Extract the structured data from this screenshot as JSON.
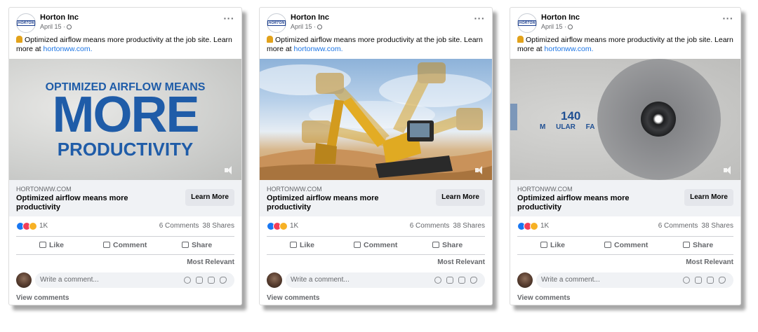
{
  "posts": [
    {
      "page_name": "Horton Inc",
      "logo_text": "HORTON",
      "date": "April 15 ·",
      "message": "Optimized airflow means more productivity at the job site. Learn more at",
      "message_link": "hortonww.com.",
      "media": {
        "type": "text-graphic",
        "line1": "OPTIMIZED AIRFLOW MEANS",
        "line2": "MORE",
        "line3": "PRODUCTIVITY"
      },
      "link_domain": "HORTONWW.COM",
      "link_title": "Optimized airflow means more productivity",
      "cta": "Learn More",
      "reaction_count": "1K",
      "comments": "6 Comments",
      "shares": "38 Shares",
      "actions": {
        "like": "Like",
        "comment": "Comment",
        "share": "Share"
      },
      "sort": "Most Relevant",
      "comment_placeholder": "Write a comment...",
      "view_comments": "View comments"
    },
    {
      "page_name": "Horton Inc",
      "logo_text": "HORTON",
      "date": "April 15 ·",
      "message": "Optimized airflow means more productivity at the job site. Learn more at",
      "message_link": "hortonww.com.",
      "media": {
        "type": "excavator-photo"
      },
      "link_domain": "HORTONWW.COM",
      "link_title": "Optimized airflow means more productivity",
      "cta": "Learn More",
      "reaction_count": "1K",
      "comments": "6 Comments",
      "shares": "38 Shares",
      "actions": {
        "like": "Like",
        "comment": "Comment",
        "share": "Share"
      },
      "sort": "Most Relevant",
      "comment_placeholder": "Write a comment...",
      "view_comments": "View comments"
    },
    {
      "page_name": "Horton Inc",
      "logo_text": "HORTON",
      "date": "April 15 ·",
      "message": "Optimized airflow means more productivity at the job site. Learn more at",
      "message_link": "hortonww.com.",
      "media": {
        "type": "fan-photo",
        "number": "140",
        "caption": "M ULAR FA"
      },
      "link_domain": "HORTONWW.COM",
      "link_title": "Optimized airflow means more productivity",
      "cta": "Learn More",
      "reaction_count": "1K",
      "comments": "6 Comments",
      "shares": "38 Shares",
      "actions": {
        "like": "Like",
        "comment": "Comment",
        "share": "Share"
      },
      "sort": "Most Relevant",
      "comment_placeholder": "Write a comment...",
      "view_comments": "View comments"
    }
  ],
  "colors": {
    "brand_blue": "#1f5ca8",
    "link_blue": "#1b74e4",
    "like_blue": "#1877f2",
    "love_red": "#f33e58",
    "haha_yellow": "#f7b125",
    "muted": "#65676b",
    "link_bg": "#f0f2f5"
  },
  "icons": [
    "ellipsis-icon",
    "globe-icon",
    "worker-emoji-icon",
    "volume-icon",
    "like-icon",
    "comment-icon",
    "share-icon",
    "emoji-icon",
    "camera-icon",
    "gif-icon",
    "sticker-icon"
  ]
}
